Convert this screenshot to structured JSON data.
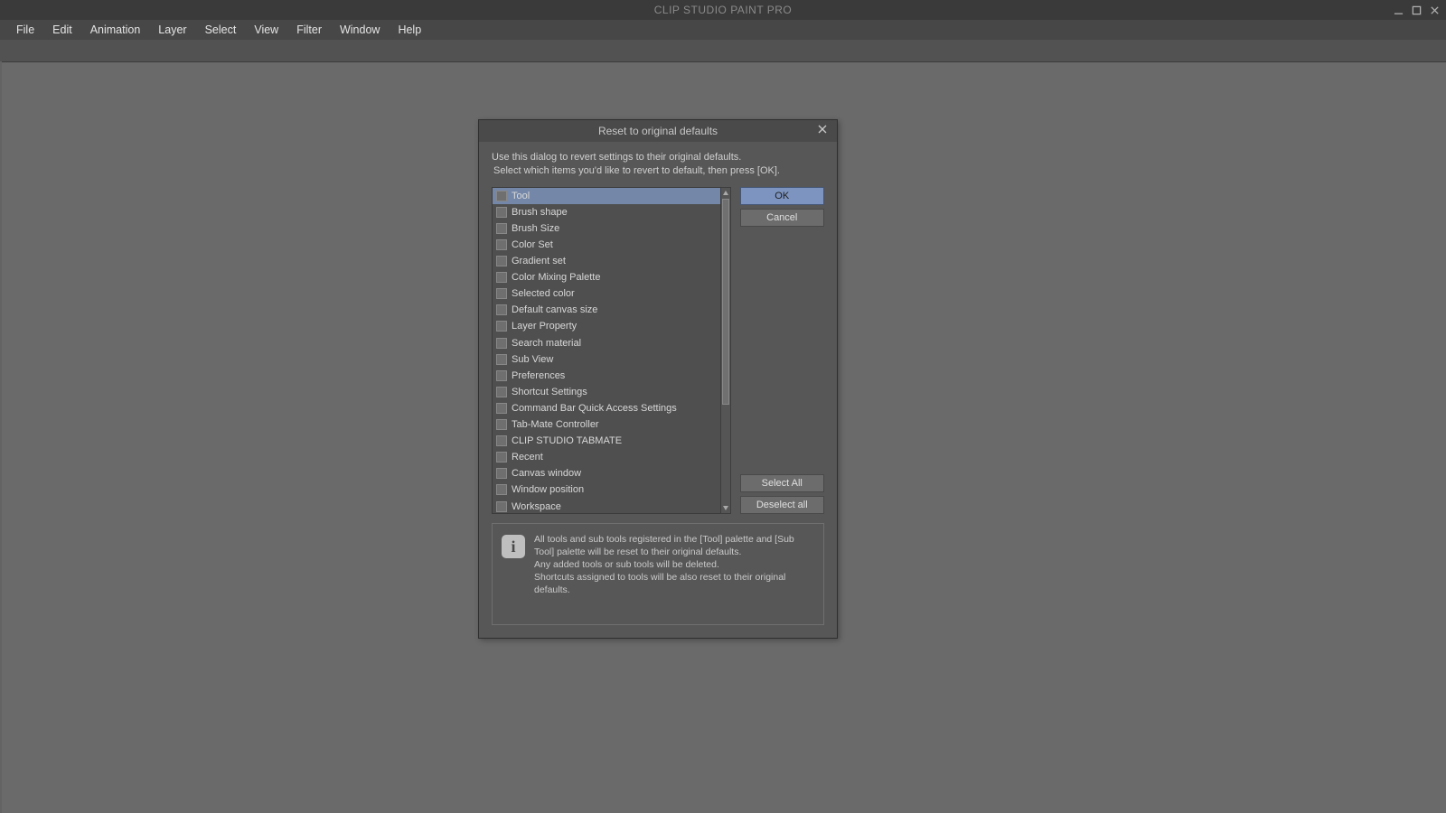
{
  "app": {
    "title": "CLIP STUDIO PAINT PRO"
  },
  "menu": {
    "items": [
      "File",
      "Edit",
      "Animation",
      "Layer",
      "Select",
      "View",
      "Filter",
      "Window",
      "Help"
    ]
  },
  "dialog": {
    "title": "Reset to original defaults",
    "desc_line1": "Use this dialog to revert settings to their original defaults.",
    "desc_line2": "Select which items you'd like to revert to default, then press [OK].",
    "items": [
      "Tool",
      "Brush shape",
      "Brush Size",
      "Color Set",
      "Gradient set",
      "Color Mixing Palette",
      "Selected color",
      "Default canvas size",
      "Layer Property",
      "Search material",
      "Sub View",
      "Preferences",
      "Shortcut Settings",
      "Command Bar Quick Access Settings",
      "Tab-Mate Controller",
      "CLIP STUDIO TABMATE",
      "Recent",
      "Canvas window",
      "Window position",
      "Workspace"
    ],
    "selected_index": 0,
    "buttons": {
      "ok": "OK",
      "cancel": "Cancel",
      "select_all": "Select All",
      "deselect_all": "Deselect all"
    },
    "info": {
      "line1": "All tools and sub tools registered in the [Tool] palette and [Sub Tool] palette will be reset to their original defaults.",
      "line2": "Any added tools or sub tools will be deleted.",
      "line3": "Shortcuts assigned to tools will be also reset to their original defaults."
    }
  }
}
